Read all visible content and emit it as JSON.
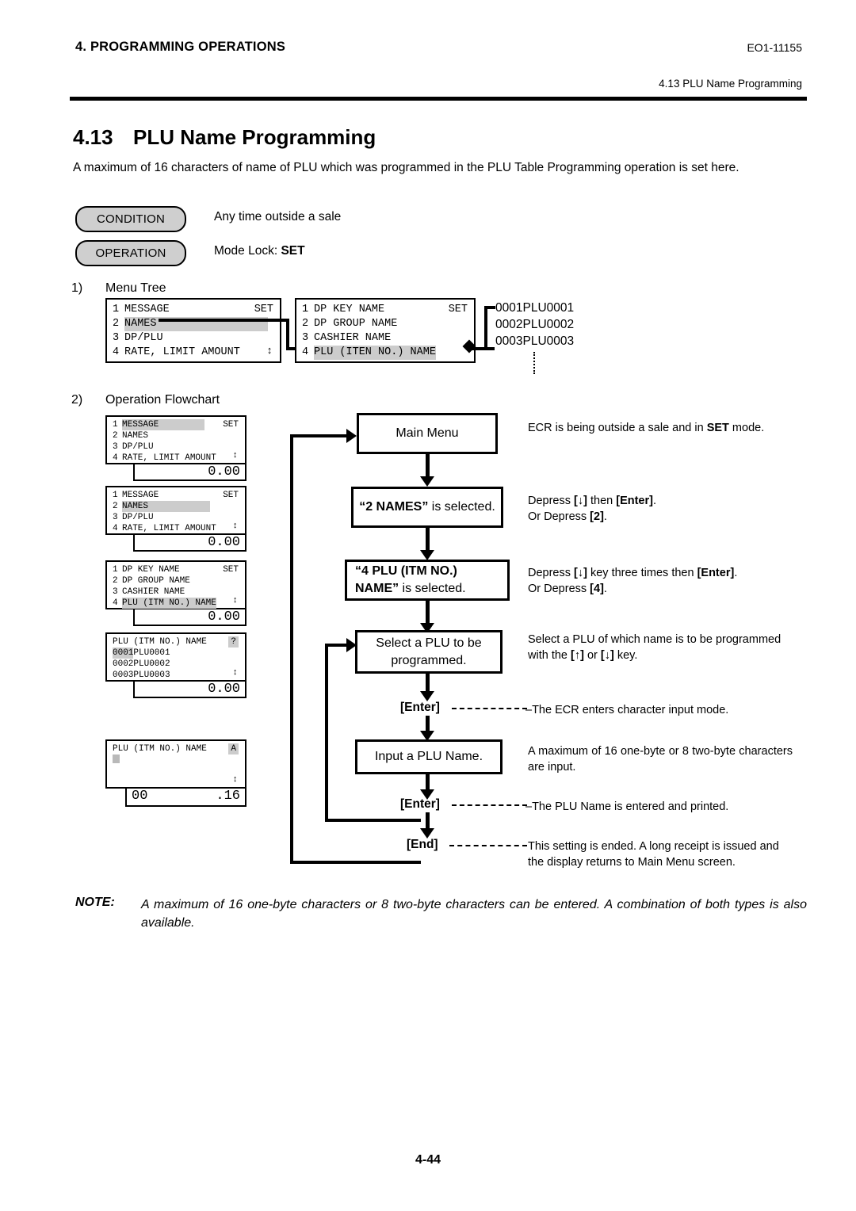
{
  "header": {
    "chapter": "4. PROGRAMMING OPERATIONS",
    "doc_code": "EO1-11155",
    "section_ref": "4.13 PLU Name Programming"
  },
  "section": {
    "number": "4.13",
    "title": "PLU Name Programming",
    "intro": "A maximum of 16 characters of name of PLU which was programmed in the PLU Table Programming operation is set here."
  },
  "pills": {
    "condition_label": "CONDITION",
    "condition_value": "Any time outside a sale",
    "operation_label": "OPERATION",
    "operation_value_prefix": "Mode Lock: ",
    "operation_value_bold": "SET"
  },
  "steps": {
    "one_num": "1)",
    "one_label": "Menu Tree",
    "two_num": "2)",
    "two_label": "Operation Flowchart"
  },
  "menu_tree": {
    "screen1": {
      "rows": [
        {
          "idx": "1",
          "text": "MESSAGE",
          "highlight": false
        },
        {
          "idx": "2",
          "text": "NAMES",
          "highlight": true
        },
        {
          "idx": "3",
          "text": "DP/PLU",
          "highlight": false
        },
        {
          "idx": "4",
          "text": "RATE, LIMIT AMOUNT",
          "highlight": false
        }
      ],
      "mode": "SET",
      "updown": "↕"
    },
    "screen2": {
      "rows": [
        {
          "idx": "1",
          "text": "DP KEY NAME",
          "highlight": false
        },
        {
          "idx": "2",
          "text": "DP GROUP NAME",
          "highlight": false
        },
        {
          "idx": "3",
          "text": "CASHIER NAME",
          "highlight": false
        },
        {
          "idx": "4",
          "text": "PLU (ITEN NO.) NAME",
          "highlight": true
        }
      ],
      "mode": "SET"
    },
    "plu_list": [
      "0001PLU0001",
      "0002PLU0002",
      "0003PLU0003"
    ]
  },
  "flow_screens": {
    "s1": {
      "rows": [
        {
          "idx": "1",
          "text": "MESSAGE",
          "highlight": true
        },
        {
          "idx": "2",
          "text": "NAMES",
          "highlight": false
        },
        {
          "idx": "3",
          "text": "DP/PLU",
          "highlight": false
        },
        {
          "idx": "4",
          "text": "RATE, LIMIT AMOUNT",
          "highlight": false
        }
      ],
      "mode": "SET",
      "updown": "↕",
      "sub_right": "0.00"
    },
    "s2": {
      "rows": [
        {
          "idx": "1",
          "text": "MESSAGE",
          "highlight": false
        },
        {
          "idx": "2",
          "text": "NAMES",
          "highlight": true
        },
        {
          "idx": "3",
          "text": "DP/PLU",
          "highlight": false
        },
        {
          "idx": "4",
          "text": "RATE, LIMIT AMOUNT",
          "highlight": false
        }
      ],
      "mode": "SET",
      "updown": "↕",
      "sub_right": "0.00"
    },
    "s3": {
      "rows": [
        {
          "idx": "1",
          "text": "DP KEY NAME",
          "highlight": false
        },
        {
          "idx": "2",
          "text": "DP GROUP NAME",
          "highlight": false
        },
        {
          "idx": "3",
          "text": "CASHIER NAME",
          "highlight": false
        },
        {
          "idx": "4",
          "text": "PLU (ITM NO.) NAME",
          "highlight": true
        }
      ],
      "mode": "SET",
      "updown": "↕",
      "sub_right": "0.00"
    },
    "s4": {
      "title": "PLU (ITM NO.) NAME",
      "badge": "?",
      "rows": [
        {
          "code": "0001",
          "name": "PLU0001",
          "highlight": true
        },
        {
          "code": "0002",
          "name": "PLU0002",
          "highlight": false
        },
        {
          "code": "0003",
          "name": "PLU0003",
          "highlight": false
        }
      ],
      "updown": "↕",
      "sub_right": "0.00"
    },
    "s5": {
      "title": "PLU (ITM NO.) NAME",
      "badge": "A",
      "updown": "↕",
      "sub_left": "00",
      "sub_right": ".16"
    }
  },
  "flowchart": {
    "box1": "Main Menu",
    "box2_quoted": "“2 NAMES”",
    "box2_rest": " is selected.",
    "box3_quoted_l1": "“4 PLU (ITM NO.)",
    "box3_quoted_l2": "NAME”",
    "box3_rest": " is selected.",
    "box4": "Select a PLU to be programmed.",
    "box5": "Input a PLU Name.",
    "key_enter_1": "[Enter]",
    "key_enter_2": "[Enter]",
    "key_end": "[End]",
    "ann1": "ECR is being outside a sale and in SET mode.",
    "ann1_pre": "ECR is being outside a sale and in ",
    "ann1_bold": "SET",
    "ann1_post": " mode.",
    "ann2_l1_pre": "Depress ",
    "ann2_l1_k1": "[↓]",
    "ann2_l1_mid": " then ",
    "ann2_l1_k2": "[Enter]",
    "ann2_l1_end": ".",
    "ann2_l2_pre": "Or Depress ",
    "ann2_l2_k": "[2]",
    "ann2_l2_end": ".",
    "ann3_l1_pre": "Depress ",
    "ann3_l1_k1": "[↓]",
    "ann3_l1_mid": " key three times then ",
    "ann3_l1_k2": "[Enter]",
    "ann3_l1_end": ".",
    "ann3_l2_pre": "Or Depress ",
    "ann3_l2_k": "[4]",
    "ann3_l2_end": ".",
    "ann4_pre": "Select a PLU of which name is to be programmed with the ",
    "ann4_k1": "[↑]",
    "ann4_mid": " or ",
    "ann4_k2": "[↓]",
    "ann4_end": " key.",
    "ann5": "The ECR enters character input mode.",
    "ann6": "A maximum of 16 one-byte or 8 two-byte characters are input.",
    "ann7": "The PLU Name is entered and printed.",
    "ann8": "This setting is ended.  A long receipt is issued and the display returns to Main Menu screen."
  },
  "note": {
    "label": "NOTE:",
    "body": "A maximum of 16 one-byte characters or 8 two-byte characters can be entered.  A combination of both types is also available."
  },
  "footer": {
    "page": "4-44"
  }
}
